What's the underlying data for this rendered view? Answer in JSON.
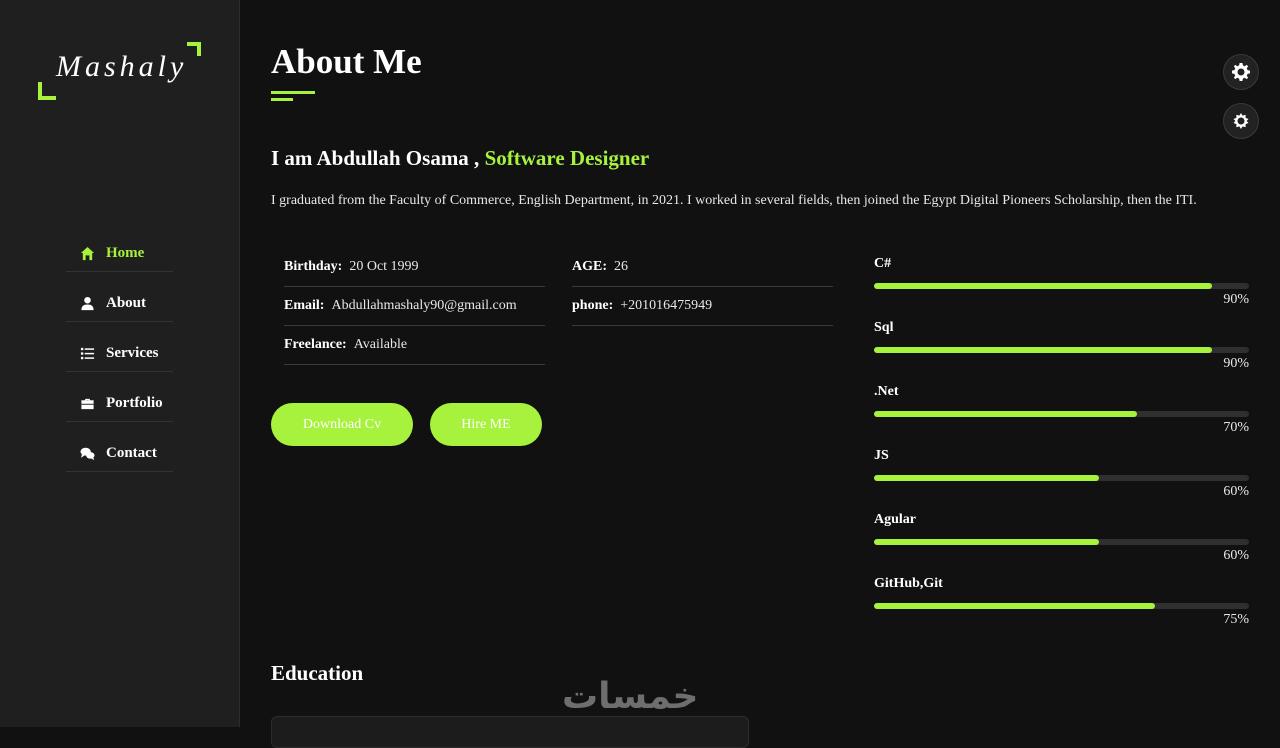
{
  "brand": {
    "logo_text": "Mashaly"
  },
  "nav": {
    "items": [
      {
        "label": "Home",
        "icon": "home-icon",
        "active": true
      },
      {
        "label": "About",
        "icon": "user-icon",
        "active": false
      },
      {
        "label": "Services",
        "icon": "list-icon",
        "active": false
      },
      {
        "label": "Portfolio",
        "icon": "briefcase-icon",
        "active": false
      },
      {
        "label": "Contact",
        "icon": "chat-icon",
        "active": false
      }
    ]
  },
  "about": {
    "title": "About Me",
    "intro_prefix": "I am Abdullah Osama ,",
    "role": "Software Designer",
    "bio": "I graduated from the Faculty of Commerce, English Department, in 2021. I worked in several fields, then joined the Egypt Digital Pioneers Scholarship, then the ITI.",
    "info": {
      "birthday": {
        "label": "Birthday:",
        "value": "20 Oct 1999"
      },
      "age": {
        "label": "AGE:",
        "value": "26"
      },
      "email": {
        "label": "Email:",
        "value": "Abdullahmashaly90@gmail.com"
      },
      "phone": {
        "label": "phone:",
        "value": "+201016475949"
      },
      "freelance": {
        "label": "Freelance:",
        "value": "Available"
      }
    },
    "buttons": {
      "download_cv": "Download Cv",
      "hire_me": "Hire ME"
    }
  },
  "skills": [
    {
      "name": "C#",
      "percent": 90,
      "label": "90%"
    },
    {
      "name": "Sql",
      "percent": 90,
      "label": "90%"
    },
    {
      "name": ".Net",
      "percent": 70,
      "label": "70%"
    },
    {
      "name": "JS",
      "percent": 60,
      "label": "60%"
    },
    {
      "name": "Agular",
      "percent": 60,
      "label": "60%"
    },
    {
      "name": "GitHub,Git",
      "percent": 75,
      "label": "75%"
    }
  ],
  "education": {
    "title": "Education"
  },
  "watermark": {
    "text": "خمسات"
  },
  "colors": {
    "accent": "#a6f23d",
    "background": "#111111",
    "sidebar": "#1f1f1f"
  },
  "toolbar": {
    "settings_icon": "gear-icon",
    "theme_icon": "sun-icon"
  }
}
